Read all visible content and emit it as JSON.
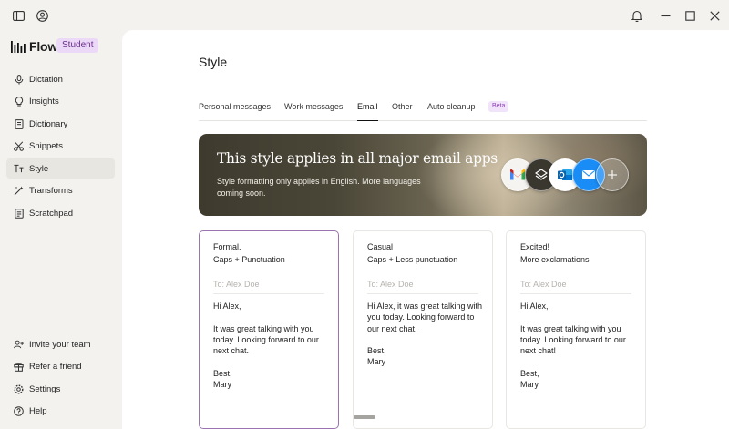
{
  "app": {
    "name": "Flow",
    "plan_badge": "Student"
  },
  "sidebar": {
    "items": [
      {
        "label": "Dictation",
        "icon": "microphone-icon"
      },
      {
        "label": "Insights",
        "icon": "lightbulb-icon"
      },
      {
        "label": "Dictionary",
        "icon": "book-icon"
      },
      {
        "label": "Snippets",
        "icon": "scissors-icon"
      },
      {
        "label": "Style",
        "icon": "text-style-icon",
        "active": true
      },
      {
        "label": "Transforms",
        "icon": "magic-wand-icon"
      },
      {
        "label": "Scratchpad",
        "icon": "notepad-icon"
      }
    ],
    "bottom_items": [
      {
        "label": "Invite your team",
        "icon": "add-people-icon"
      },
      {
        "label": "Refer a friend",
        "icon": "gift-icon"
      },
      {
        "label": "Settings",
        "icon": "gear-icon"
      },
      {
        "label": "Help",
        "icon": "help-icon"
      }
    ]
  },
  "page": {
    "title": "Style"
  },
  "tabs": [
    {
      "label": "Personal messages"
    },
    {
      "label": "Work messages"
    },
    {
      "label": "Email",
      "active": true
    },
    {
      "label": "Other"
    },
    {
      "label": "Auto cleanup"
    }
  ],
  "beta_badge": "Beta",
  "banner": {
    "title": "This style applies in all major email apps",
    "subtitle": "Style formatting only applies in English. More languages coming soon.",
    "apps": [
      "gmail-icon",
      "superhuman-icon",
      "outlook-icon",
      "apple-mail-icon",
      "add-icon"
    ]
  },
  "cards": [
    {
      "name": "Formal.",
      "description": "Caps + Punctuation",
      "to": "To: Alex Doe",
      "greeting": "Hi Alex,",
      "body": "It was great talking with you today. Looking forward to our next chat.",
      "closing": "Best,",
      "signature": "Mary",
      "selected": true
    },
    {
      "name": "Casual",
      "description": "Caps + Less punctuation",
      "to": "To: Alex Doe",
      "greeting": "Hi Alex, it was great talking with you today. Looking forward to our next chat.",
      "body": "",
      "closing": "Best,",
      "signature": "Mary",
      "selected": false
    },
    {
      "name": "Excited!",
      "description": "More exclamations",
      "to": "To: Alex Doe",
      "greeting": "Hi Alex,",
      "body": "It was great talking with you today. Looking forward to our next chat!",
      "closing": "Best,",
      "signature": "Mary",
      "selected": false
    }
  ],
  "colors": {
    "selected_border": "#9b73b0",
    "badge_bg": "#ecd9f7",
    "badge_text": "#6b2f8a",
    "active_nav_bg": "#e8e6e1"
  }
}
